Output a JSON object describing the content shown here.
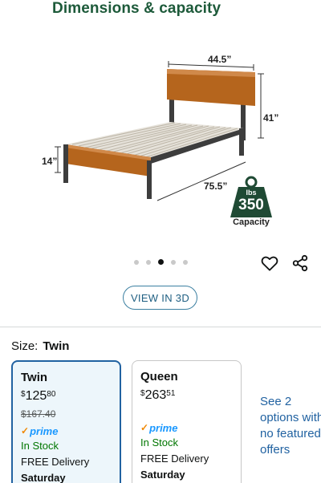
{
  "hero": {
    "title": "Dimensions & capacity",
    "dim_width": "44.5”",
    "dim_height": "41”",
    "dim_length": "75.5”",
    "dim_clearance": "14”",
    "badge_unit": "lbs",
    "badge_value": "350",
    "badge_caption": "Capacity"
  },
  "carousel": {
    "dot_count": 5,
    "active_index": 2
  },
  "actions": {
    "favorite_icon": "heart-outline-icon",
    "share_icon": "share-icon",
    "view_3d_label": "VIEW IN 3D"
  },
  "size": {
    "label": "Size:",
    "selected": "Twin"
  },
  "options": [
    {
      "name": "Twin",
      "price_symbol": "$",
      "price_whole": "125",
      "price_fraction": "80",
      "list_price": "$167.40",
      "prime_label": "prime",
      "stock": "In Stock",
      "delivery": "FREE Delivery",
      "day": "Saturday"
    },
    {
      "name": "Queen",
      "price_symbol": "$",
      "price_whole": "263",
      "price_fraction": "51",
      "prime_label": "prime",
      "stock": "In Stock",
      "delivery": "FREE Delivery",
      "day": "Saturday"
    }
  ],
  "more_options": {
    "line1": "See 2",
    "line2": "options with",
    "line3": "no featured",
    "line4": "offers"
  },
  "colors": {
    "title_green": "#1d5a3a",
    "link_blue": "#2162a1",
    "stock_green": "#007600",
    "prime_blue": "#1a98ff",
    "wood": "#b5651d",
    "badge": "#1f4a34"
  }
}
